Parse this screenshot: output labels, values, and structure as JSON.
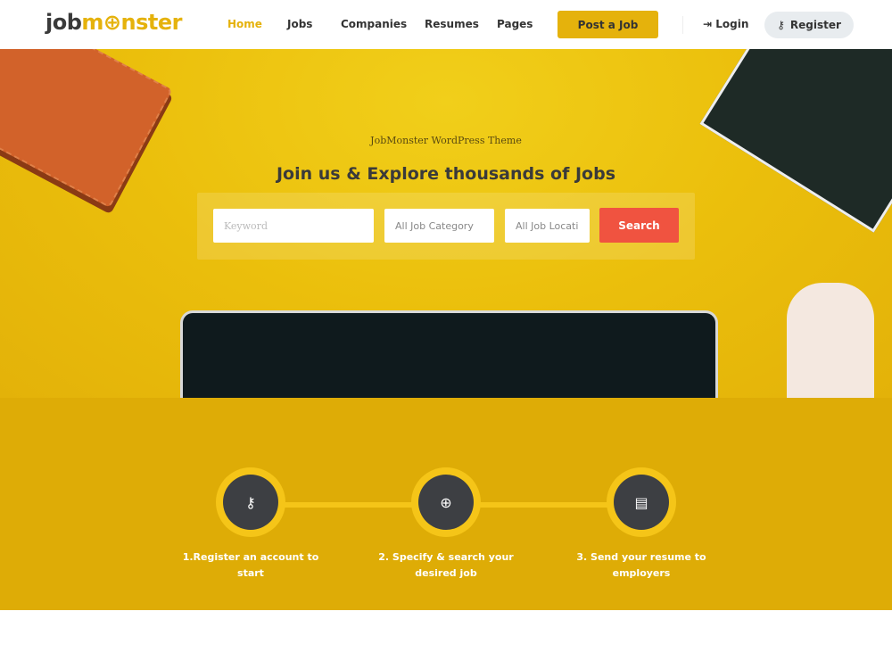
{
  "nav": {
    "logo": {
      "part1": "job",
      "part2": "m",
      "part3": "nster",
      "o_icon": "monster-eye-icon"
    },
    "items": [
      {
        "label": "Home",
        "active": true
      },
      {
        "label": "Jobs"
      },
      {
        "label": "Companies"
      },
      {
        "label": "Resumes"
      },
      {
        "label": "Pages"
      }
    ],
    "post_job": "Post a Job",
    "login": "Login",
    "register": "Register"
  },
  "hero": {
    "subtitle": "JobMonster WordPress Theme",
    "title": "Join us & Explore thousands of Jobs",
    "search": {
      "keyword_placeholder": "Keyword",
      "category": "All Job Category",
      "location": "All Job Locati",
      "button": "Search"
    }
  },
  "steps": [
    {
      "icon": "key-icon",
      "label": "1.Register an account to start"
    },
    {
      "icon": "search-plus-icon",
      "label": "2. Specify & search your desired job"
    },
    {
      "icon": "document-icon",
      "label": "3. Send your resume to employers"
    }
  ],
  "colors": {
    "accent": "#e5b20c",
    "search": "#f05340",
    "dark": "#3d3f43"
  }
}
